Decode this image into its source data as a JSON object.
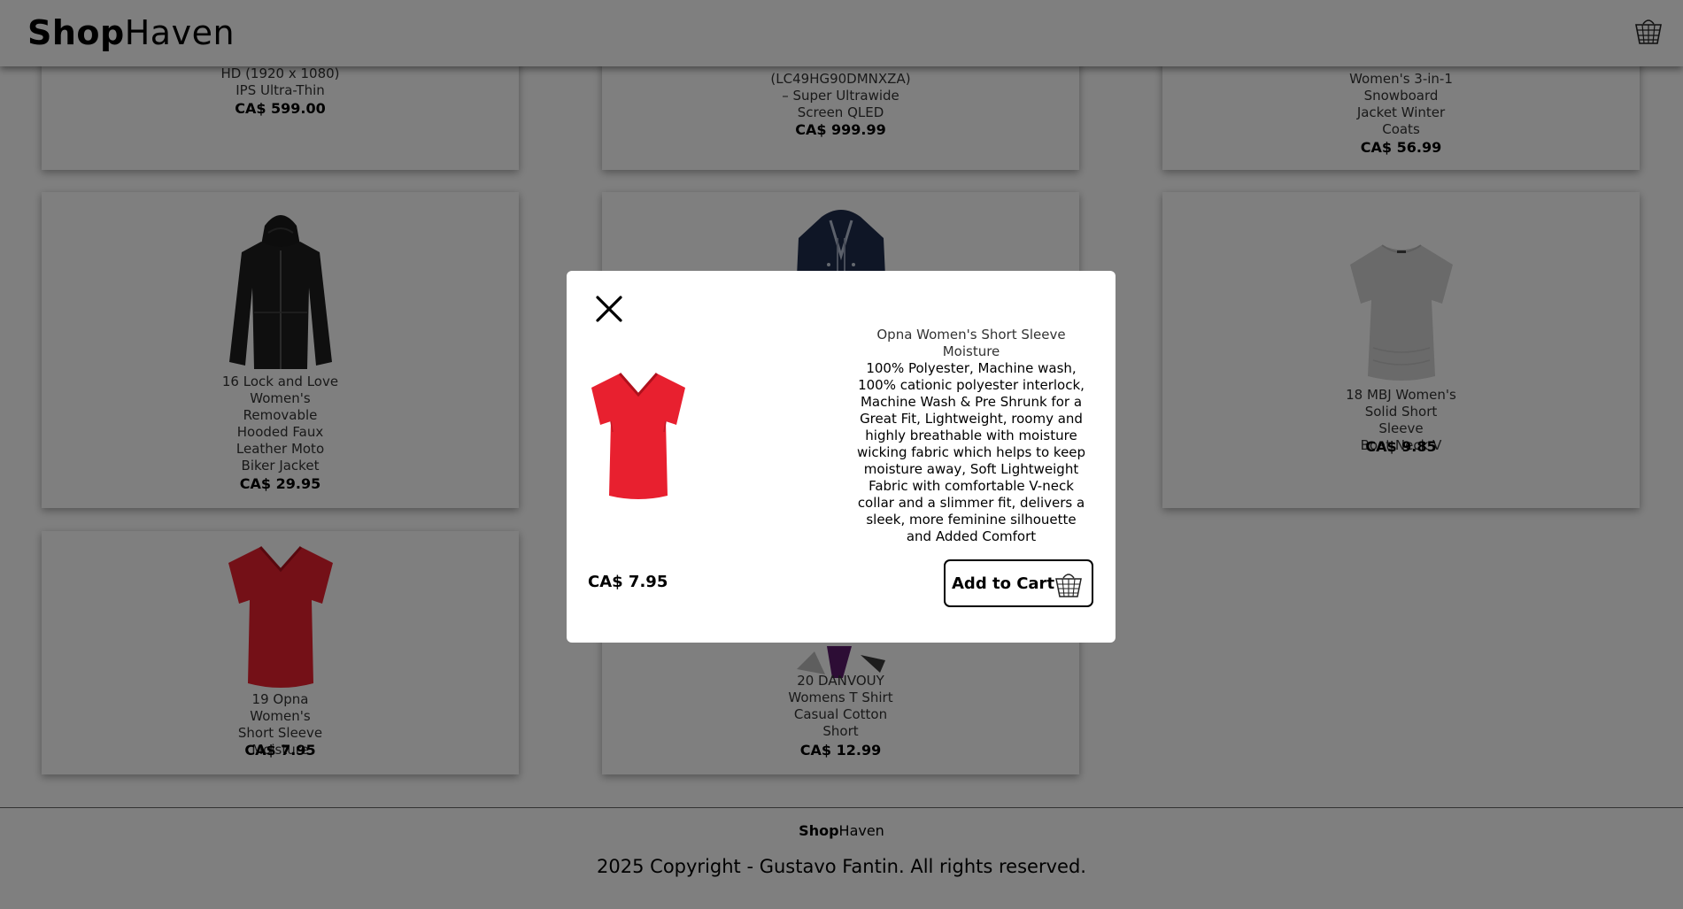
{
  "header": {
    "logo_bold": "Shop",
    "logo_regular": "Haven",
    "cart_icon": "basket-icon"
  },
  "products": [
    {
      "lines": [
        "HD (1920 x 1080)",
        "IPS Ultra-Thin"
      ],
      "price": "CA$ 599.00"
    },
    {
      "lines": [
        "(LC49HG90DMNXZA)",
        "– Super Ultrawide",
        "Screen QLED"
      ],
      "price": "CA$ 999.99"
    },
    {
      "lines": [
        "Women's 3-in-1",
        "Snowboard",
        "Jacket Winter",
        "Coats"
      ],
      "price": "CA$ 56.99"
    },
    {
      "lines": [
        "16 Lock and Love",
        "Women's",
        "Removable",
        "Hooded Faux",
        "Leather Moto",
        "Biker Jacket"
      ],
      "price": "CA$ 29.95"
    },
    {
      "lines": [],
      "price": ""
    },
    {
      "lines": [
        "18 MBJ Women's",
        "Solid Short Sleeve",
        "Boat Neck V"
      ],
      "price": "CA$ 9.85"
    },
    {
      "lines": [
        "19 Opna Women's",
        "Short Sleeve",
        "Moisture"
      ],
      "price": "CA$ 7.95"
    },
    {
      "lines": [
        "20 DANVOUY",
        "Womens T Shirt",
        "Casual Cotton",
        "Short"
      ],
      "price": "CA$ 12.99"
    }
  ],
  "modal": {
    "title": "Opna Women's Short Sleeve Moisture",
    "description": "100% Polyester, Machine wash, 100% cationic polyester interlock, Machine Wash & Pre Shrunk for a Great Fit, Lightweight, roomy and highly breathable with moisture wicking fabric which helps to keep moisture away, Soft Lightweight Fabric with comfortable V-neck collar and a slimmer fit, delivers a sleek, more feminine silhouette and Added Comfort",
    "price": "CA$ 7.95",
    "add_to_cart_label": "Add to Cart"
  },
  "footer": {
    "logo_bold": "Shop",
    "logo_regular": "Haven",
    "copyright": "2025 Copyright - Gustavo Fantin. All rights reserved."
  },
  "colors": {
    "overlay": "#000000",
    "tshirt_red": "#e8202f",
    "jacket_black": "#1a1a1a",
    "jacket_navy": "#1f2d4d"
  }
}
